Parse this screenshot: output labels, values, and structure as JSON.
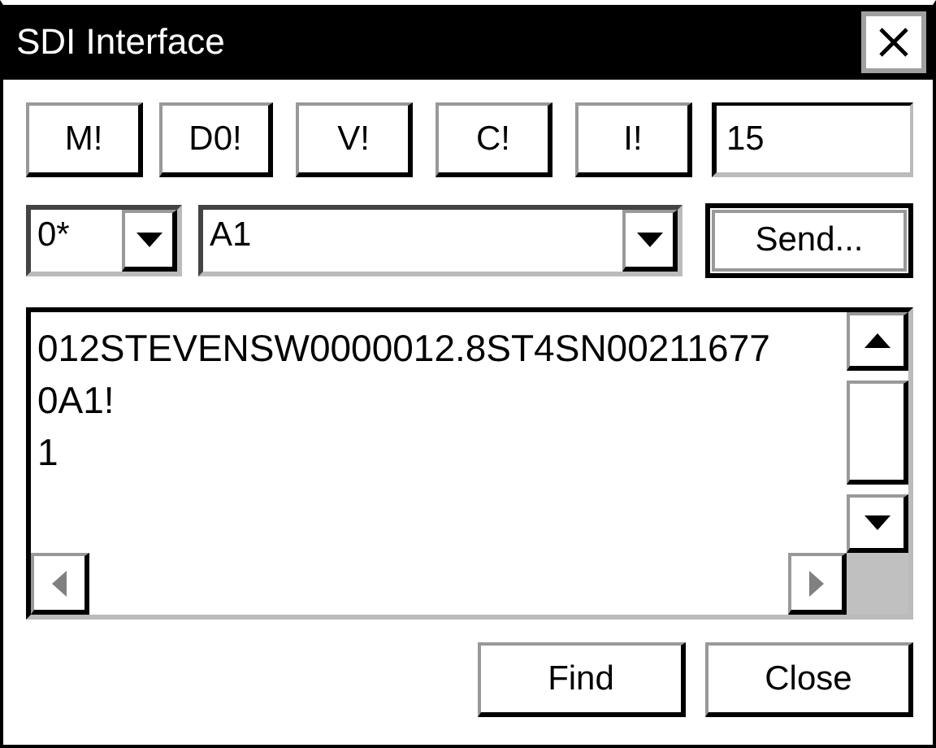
{
  "window": {
    "title": "SDI Interface"
  },
  "command_buttons": [
    "M!",
    "D0!",
    "V!",
    "C!",
    "I!"
  ],
  "value_field": {
    "value": "15"
  },
  "address_combo": {
    "value": "0*"
  },
  "command_combo": {
    "value": "A1"
  },
  "send_button": "Send...",
  "output": {
    "lines": [
      "012STEVENSW0000012.8ST4SN00211677",
      "0A1!",
      "1"
    ]
  },
  "buttons": [
    "Find",
    "Close"
  ]
}
